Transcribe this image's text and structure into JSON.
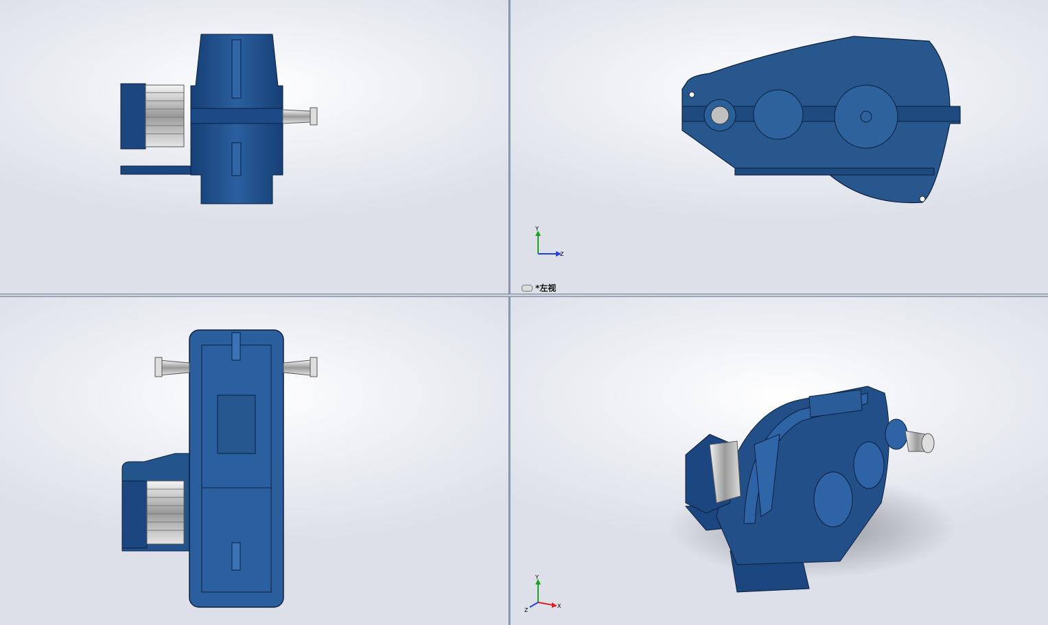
{
  "viewports": {
    "top_left": {
      "label": ""
    },
    "top_right": {
      "label": "*左视",
      "triad": {
        "y": "Y",
        "z": "Z"
      }
    },
    "bottom_left": {
      "label": ""
    },
    "bottom_right": {
      "label": "",
      "triad": {
        "y": "Y",
        "x": "X",
        "z": "Z"
      }
    }
  },
  "colors": {
    "model_blue": "#1f4e8c",
    "model_dark": "#0f2c57",
    "gear_silver": "#c8c8c8",
    "axis_x": "#e02020",
    "axis_y": "#20a020",
    "axis_z": "#2040e0"
  },
  "icons": [
    "link-views-icon",
    "triad-icon"
  ]
}
